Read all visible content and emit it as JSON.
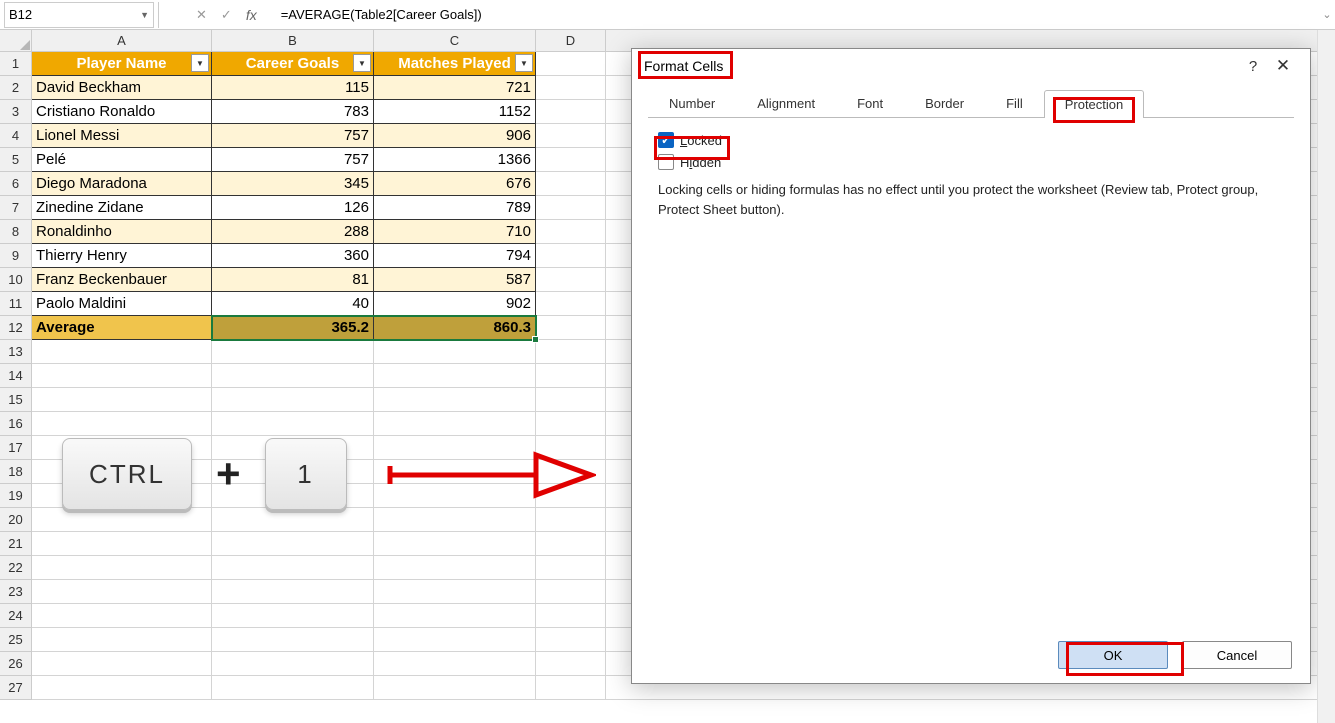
{
  "nameBox": {
    "value": "B12"
  },
  "formula": {
    "value": "=AVERAGE(Table2[Career Goals])"
  },
  "columns": [
    "A",
    "B",
    "C",
    "D"
  ],
  "colWidths": {
    "A": 180,
    "B": 162,
    "C": 162,
    "D": 70
  },
  "tableHeaders": {
    "A": "Player Name",
    "B": "Career Goals",
    "C": "Matches Played"
  },
  "rows": [
    {
      "A": "David Beckham",
      "B": "115",
      "C": "721"
    },
    {
      "A": "Cristiano Ronaldo",
      "B": "783",
      "C": "1152"
    },
    {
      "A": "Lionel Messi",
      "B": "757",
      "C": "906"
    },
    {
      "A": "Pelé",
      "B": "757",
      "C": "1366"
    },
    {
      "A": "Diego Maradona",
      "B": "345",
      "C": "676"
    },
    {
      "A": "Zinedine Zidane",
      "B": "126",
      "C": "789"
    },
    {
      "A": "Ronaldinho",
      "B": "288",
      "C": "710"
    },
    {
      "A": "Thierry Henry",
      "B": "360",
      "C": "794"
    },
    {
      "A": "Franz Beckenbauer",
      "B": "81",
      "C": "587"
    },
    {
      "A": "Paolo Maldini",
      "B": "40",
      "C": "902"
    }
  ],
  "averageRow": {
    "A": "Average",
    "B": "365.2",
    "C": "860.3"
  },
  "keys": {
    "ctrl": "CTRL",
    "plus": "+",
    "one": "1"
  },
  "dialog": {
    "title": "Format Cells",
    "tabs": [
      "Number",
      "Alignment",
      "Font",
      "Border",
      "Fill",
      "Protection"
    ],
    "activeTab": "Protection",
    "locked": {
      "label": "Locked",
      "checked": true,
      "underlineChar": "L"
    },
    "hidden": {
      "label": "Hidden",
      "checked": false,
      "underlineChar": "i"
    },
    "note": "Locking cells or hiding formulas has no effect until you protect the worksheet (Review tab, Protect group, Protect Sheet button).",
    "ok": "OK",
    "cancel": "Cancel",
    "help": "?"
  }
}
